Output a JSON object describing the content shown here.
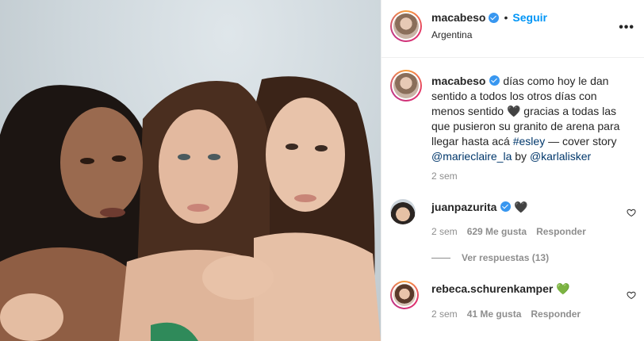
{
  "post": {
    "author": "macabeso",
    "follow_label": "Seguir",
    "separator": "•",
    "location": "Argentina",
    "more_label": "•••",
    "caption": {
      "username": "macabeso",
      "text_1": " días como hoy le dan sentido a todos los otros días con menos sentido ",
      "emoji_1": "🖤",
      "text_2": " gracias a todas las que pusieron su granito de arena para llegar hasta acá ",
      "hashtag": "#esley",
      "text_3": " — cover story ",
      "mention_1": "@marieclaire_la",
      "text_4": " by ",
      "mention_2": "@karlalisker",
      "time": "2 sem"
    },
    "comments": [
      {
        "username": "juanpazurita",
        "verified": true,
        "text": " 🖤",
        "time": "2 sem",
        "likes": "629 Me gusta",
        "reply_label": "Responder",
        "view_replies": "Ver respuestas (13)"
      },
      {
        "username": "rebeca.schurenkamper",
        "verified": false,
        "text": " 💚",
        "time": "2 sem",
        "likes": "41 Me gusta",
        "reply_label": "Responder"
      }
    ]
  },
  "colors": {
    "link": "#0095f6",
    "tag": "#00376b",
    "muted": "#8e8e8e",
    "verified": "#3897f0"
  }
}
